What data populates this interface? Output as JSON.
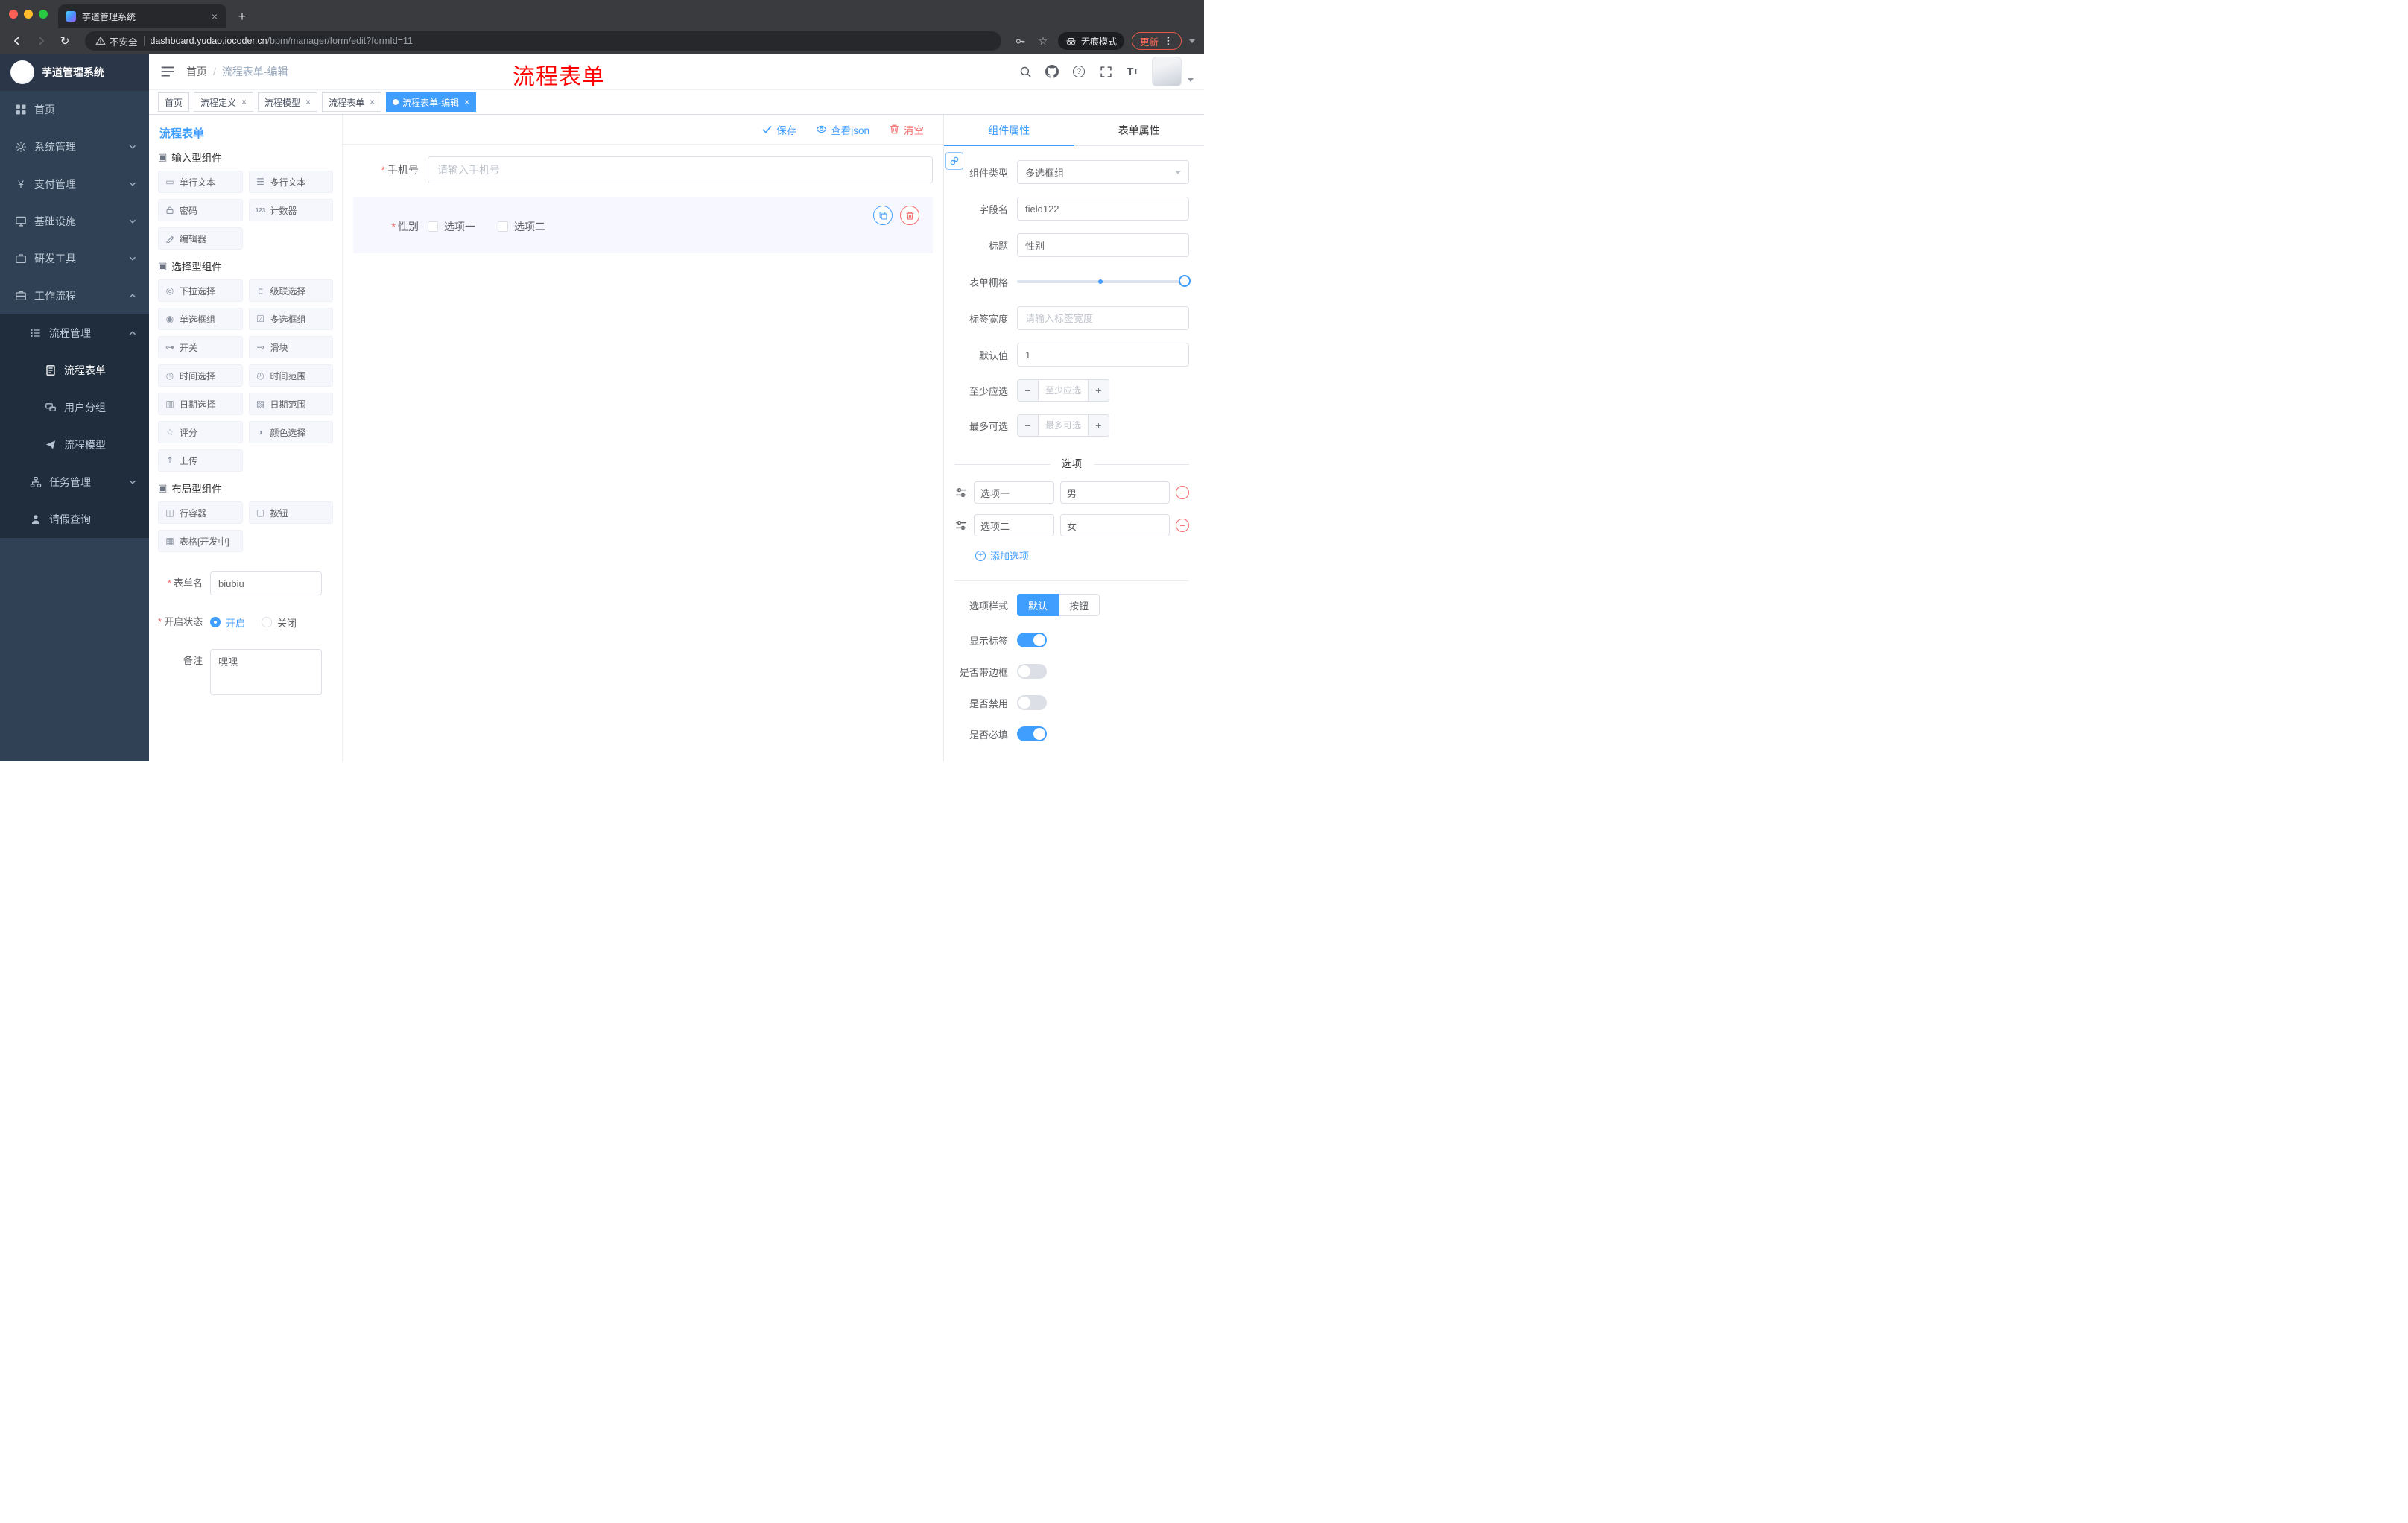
{
  "browser": {
    "tab": {
      "title": "芋道管理系统"
    },
    "address": {
      "security": "不安全",
      "domain": "dashboard.yudao.iocoder.cn",
      "path": "/bpm/manager/form/edit?formId=11"
    },
    "incognito_label": "无痕模式",
    "update_label": "更新"
  },
  "sidebar": {
    "logo": "芋道管理系统",
    "items": [
      {
        "icon": "home-icon",
        "label": "首页"
      },
      {
        "icon": "gear-icon",
        "label": "系统管理"
      },
      {
        "icon": "yen-icon",
        "label": "支付管理"
      },
      {
        "icon": "infrastructure-icon",
        "label": "基础设施"
      },
      {
        "icon": "dev-tools-icon",
        "label": "研发工具"
      },
      {
        "icon": "workflow-icon",
        "label": "工作流程"
      },
      {
        "icon": "process-manage-icon",
        "label": "流程管理"
      },
      {
        "icon": "process-form-icon",
        "label": "流程表单"
      },
      {
        "icon": "user-group-icon",
        "label": "用户分组"
      },
      {
        "icon": "process-model-icon",
        "label": "流程模型"
      },
      {
        "icon": "task-manage-icon",
        "label": "任务管理"
      },
      {
        "icon": "leave-query-icon",
        "label": "请假查询"
      }
    ]
  },
  "header": {
    "breadcrumb": {
      "root": "首页",
      "separator": "/",
      "current": "流程表单-编辑"
    },
    "annotation": "流程表单"
  },
  "tags": [
    {
      "label": "首页"
    },
    {
      "label": "流程定义"
    },
    {
      "label": "流程模型"
    },
    {
      "label": "流程表单"
    },
    {
      "label": "流程表单-编辑"
    }
  ],
  "palette": {
    "title": "流程表单",
    "sections": [
      {
        "title": "输入型组件",
        "items": [
          {
            "icon": "single-line-text-icon",
            "label": "单行文本"
          },
          {
            "icon": "multi-line-text-icon",
            "label": "多行文本"
          },
          {
            "icon": "password-icon",
            "label": "密码"
          },
          {
            "icon": "counter-icon",
            "label": "计数器"
          },
          {
            "icon": "editor-icon",
            "label": "编辑器"
          }
        ]
      },
      {
        "title": "选择型组件",
        "items": [
          {
            "icon": "select-icon",
            "label": "下拉选择"
          },
          {
            "icon": "cascader-icon",
            "label": "级联选择"
          },
          {
            "icon": "radio-group-icon",
            "label": "单选框组"
          },
          {
            "icon": "checkbox-group-icon",
            "label": "多选框组"
          },
          {
            "icon": "switch-icon",
            "label": "开关"
          },
          {
            "icon": "slider-icon",
            "label": "滑块"
          },
          {
            "icon": "time-picker-icon",
            "label": "时间选择"
          },
          {
            "icon": "time-range-icon",
            "label": "时间范围"
          },
          {
            "icon": "date-picker-icon",
            "label": "日期选择"
          },
          {
            "icon": "date-range-icon",
            "label": "日期范围"
          },
          {
            "icon": "rate-icon",
            "label": "评分"
          },
          {
            "icon": "color-picker-icon",
            "label": "颜色选择"
          },
          {
            "icon": "upload-icon",
            "label": "上传"
          }
        ]
      },
      {
        "title": "布局型组件",
        "items": [
          {
            "icon": "row-container-icon",
            "label": "行容器"
          },
          {
            "icon": "button-icon",
            "label": "按钮"
          },
          {
            "icon": "table-icon",
            "label": "表格[开发中]"
          }
        ]
      }
    ],
    "form": {
      "name_label": "表单名",
      "name_value": "biubiu",
      "status_label": "开启状态",
      "status_on": "开启",
      "status_off": "关闭",
      "remark_label": "备注",
      "remark_value": "嘿嘿"
    }
  },
  "canvas": {
    "toolbar": {
      "save": "保存",
      "view_json": "查看json",
      "clear": "清空"
    },
    "phone": {
      "label": "手机号",
      "placeholder": "请输入手机号"
    },
    "gender": {
      "label": "性别",
      "option1": "选项一",
      "option2": "选项二"
    }
  },
  "props": {
    "tabs": {
      "component": "组件属性",
      "form": "表单属性"
    },
    "component_type": {
      "label": "组件类型",
      "value": "多选框组"
    },
    "field_name": {
      "label": "字段名",
      "value": "field122"
    },
    "title": {
      "label": "标题",
      "value": "性别"
    },
    "grid": {
      "label": "表单栅格"
    },
    "label_width": {
      "label": "标签宽度",
      "placeholder": "请输入标签宽度"
    },
    "default": {
      "label": "默认值",
      "value": "1"
    },
    "min": {
      "label": "至少应选",
      "placeholder": "至少应选"
    },
    "max": {
      "label": "最多可选",
      "placeholder": "最多可选"
    },
    "options": {
      "title": "选项",
      "rows": [
        {
          "label": "选项一",
          "value": "男"
        },
        {
          "label": "选项二",
          "value": "女"
        }
      ],
      "add": "添加选项"
    },
    "style": {
      "label": "选项样式",
      "default": "默认",
      "button": "按钮"
    },
    "switches": {
      "show_label": "显示标签",
      "border": "是否带边框",
      "disabled": "是否禁用",
      "required": "是否必填"
    }
  }
}
